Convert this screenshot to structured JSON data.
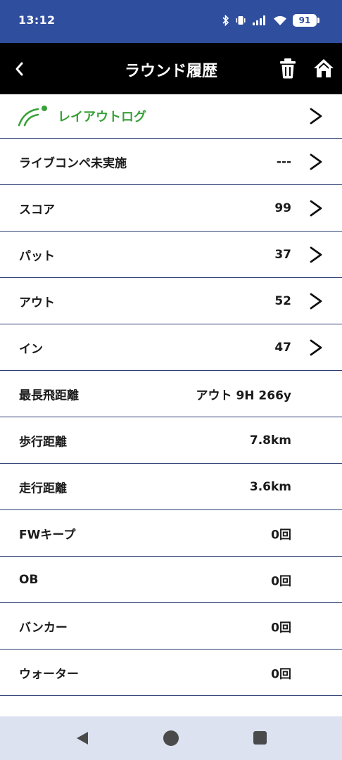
{
  "status_bar": {
    "time": "13:12",
    "battery": "91",
    "icons": [
      "bluetooth-icon",
      "vibrate-icon",
      "signal-icon",
      "wifi-icon",
      "battery-icon"
    ]
  },
  "app_bar": {
    "title": "ラウンド履歴",
    "back_icon": "chevron-left-icon",
    "delete_icon": "trash-icon",
    "home_icon": "home-icon"
  },
  "layout_log": {
    "label": "レイアウトログ",
    "icon": "layout-log-icon",
    "accent_color": "#3aa13a"
  },
  "rows": [
    {
      "label": "ライブコンペ未実施",
      "value": "---",
      "chevron": true
    },
    {
      "label": "スコア",
      "value": "99",
      "chevron": true
    },
    {
      "label": "パット",
      "value": "37",
      "chevron": true
    },
    {
      "label": "アウト",
      "value": "52",
      "chevron": true
    },
    {
      "label": "イン",
      "value": "47",
      "chevron": true
    },
    {
      "label": "最長飛距離",
      "value": "アウト 9H 266y",
      "chevron": false
    },
    {
      "label": "歩行距離",
      "value": "7.8km",
      "chevron": false
    },
    {
      "label": "走行距離",
      "value": "3.6km",
      "chevron": false
    },
    {
      "label": "FWキープ",
      "value": "0回",
      "chevron": false
    },
    {
      "label": "OB",
      "value": "0回",
      "chevron": false
    },
    {
      "label": "バンカー",
      "value": "0回",
      "chevron": false
    },
    {
      "label": "ウォーター",
      "value": "0回",
      "chevron": false
    }
  ],
  "colors": {
    "status_bar": "#2f4e9e",
    "app_bar": "#000000",
    "divider": "#2c3e73",
    "nav_bar": "#dce2f0"
  },
  "nav_bar": {
    "icons": [
      "nav-back-icon",
      "nav-home-icon",
      "nav-recents-icon"
    ]
  }
}
